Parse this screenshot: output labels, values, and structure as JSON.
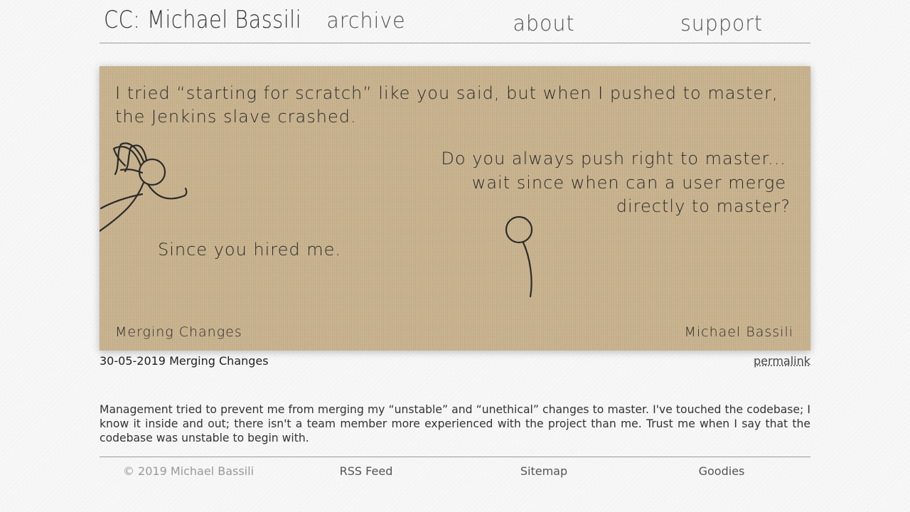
{
  "header": {
    "site_title": "CC: Michael Bassili",
    "nav": [
      {
        "label": "archive"
      },
      {
        "label": "about"
      },
      {
        "label": "support"
      }
    ]
  },
  "comic": {
    "lines": [
      "I tried “starting for scratch” like you said, but when I pushed to master,",
      "the Jenkins slave crashed.",
      "Do you always push right to master...",
      "wait since when can a user merge",
      "directly to master?",
      "Since you hired me."
    ],
    "signature_title": "Merging Changes",
    "signature_author": "Michael Bassili",
    "background_color": "#c9b38e"
  },
  "post": {
    "date_title": "30-05-2019 Merging Changes",
    "permalink_label": "permalink",
    "description": "Management tried to prevent me from merging my “unstable” and “unethical” changes to master. I've touched the codebase; I know it inside and out; there isn't a team member more experienced with the project than me. Trust me when I say that the codebase was unstable to begin with."
  },
  "footer": {
    "copyright": "© 2019 Michael Bassili",
    "rss": "RSS Feed",
    "sitemap": "Sitemap",
    "goodies": "Goodies"
  }
}
